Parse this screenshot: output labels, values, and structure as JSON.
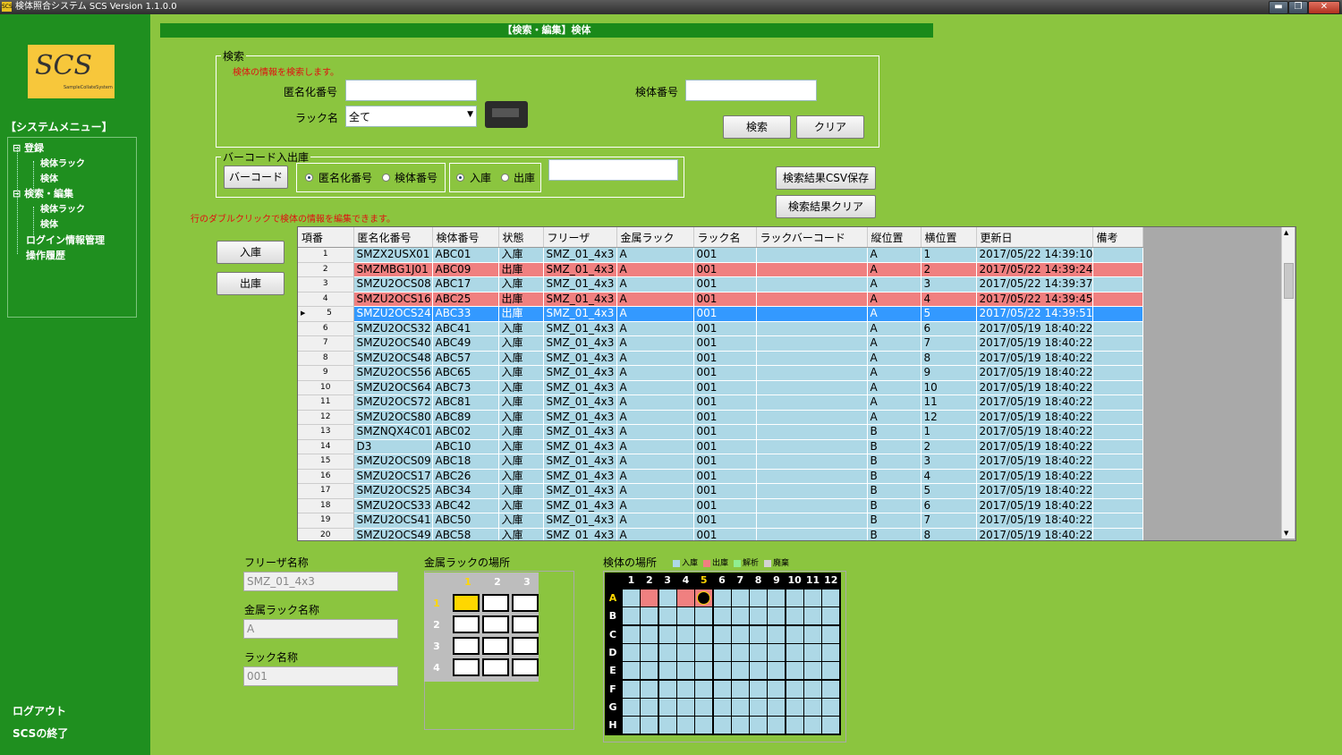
{
  "window": {
    "title": "検体照合システム  SCS Version 1.1.0.0",
    "app_icon": "SCS"
  },
  "logo": {
    "text": "SCS",
    "sub": "SampleCollateSystem"
  },
  "sidebar": {
    "menu_title": "【システムメニュー】",
    "items": [
      {
        "label": "登録",
        "level": 0
      },
      {
        "label": "検体ラック",
        "level": 1
      },
      {
        "label": "検体",
        "level": 1
      },
      {
        "label": "検索・編集",
        "level": 0
      },
      {
        "label": "検体ラック",
        "level": 1
      },
      {
        "label": "検体",
        "level": 1
      },
      {
        "label": "ログイン情報管理",
        "level": 0
      },
      {
        "label": "操作履歴",
        "level": 0
      }
    ],
    "logout": "ログアウト",
    "quit": "SCSの終了"
  },
  "header": {
    "title": "【検索・編集】検体"
  },
  "search": {
    "legend": "検索",
    "hint": "検体の情報を検索します。",
    "anon_label": "匿名化番号",
    "anon_value": "",
    "sample_label": "検体番号",
    "sample_value": "",
    "rack_label": "ラック名",
    "rack_value": "全て",
    "search_btn": "検索",
    "clear_btn": "クリア"
  },
  "barcode": {
    "legend": "バーコード入出庫",
    "barcode_btn": "バーコード",
    "opt_anon": "匿名化番号",
    "opt_sample": "検体番号",
    "opt_in": "入庫",
    "opt_out": "出庫",
    "value": ""
  },
  "actions": {
    "csv_save": "検索結果CSV保存",
    "result_clear": "検索結果クリア",
    "in_btn": "入庫",
    "out_btn": "出庫"
  },
  "grid_hint": "行のダブルクリックで検体の情報を編集できます。",
  "table": {
    "columns": [
      "項番",
      "匿名化番号",
      "検体番号",
      "状態",
      "フリーザ",
      "金属ラック",
      "ラック名",
      "ラックバーコード",
      "縦位置",
      "横位置",
      "更新日",
      "備考"
    ],
    "rows": [
      [
        "1",
        "SMZX2USX01",
        "ABC01",
        "入庫",
        "SMZ_01_4x3",
        "A",
        "001",
        "",
        "A",
        "1",
        "2017/05/22 14:39:10",
        ""
      ],
      [
        "2",
        "SMZMBG1J01",
        "ABC09",
        "出庫",
        "SMZ_01_4x3",
        "A",
        "001",
        "",
        "A",
        "2",
        "2017/05/22 14:39:24",
        ""
      ],
      [
        "3",
        "SMZU2OCS08",
        "ABC17",
        "入庫",
        "SMZ_01_4x3",
        "A",
        "001",
        "",
        "A",
        "3",
        "2017/05/22 14:39:37",
        ""
      ],
      [
        "4",
        "SMZU2OCS16",
        "ABC25",
        "出庫",
        "SMZ_01_4x3",
        "A",
        "001",
        "",
        "A",
        "4",
        "2017/05/22 14:39:45",
        ""
      ],
      [
        "5",
        "SMZU2OCS24",
        "ABC33",
        "出庫",
        "SMZ_01_4x3",
        "A",
        "001",
        "",
        "A",
        "5",
        "2017/05/22 14:39:51",
        ""
      ],
      [
        "6",
        "SMZU2OCS32",
        "ABC41",
        "入庫",
        "SMZ_01_4x3",
        "A",
        "001",
        "",
        "A",
        "6",
        "2017/05/19 18:40:22",
        ""
      ],
      [
        "7",
        "SMZU2OCS40",
        "ABC49",
        "入庫",
        "SMZ_01_4x3",
        "A",
        "001",
        "",
        "A",
        "7",
        "2017/05/19 18:40:22",
        ""
      ],
      [
        "8",
        "SMZU2OCS48",
        "ABC57",
        "入庫",
        "SMZ_01_4x3",
        "A",
        "001",
        "",
        "A",
        "8",
        "2017/05/19 18:40:22",
        ""
      ],
      [
        "9",
        "SMZU2OCS56",
        "ABC65",
        "入庫",
        "SMZ_01_4x3",
        "A",
        "001",
        "",
        "A",
        "9",
        "2017/05/19 18:40:22",
        ""
      ],
      [
        "10",
        "SMZU2OCS64",
        "ABC73",
        "入庫",
        "SMZ_01_4x3",
        "A",
        "001",
        "",
        "A",
        "10",
        "2017/05/19 18:40:22",
        ""
      ],
      [
        "11",
        "SMZU2OCS72",
        "ABC81",
        "入庫",
        "SMZ_01_4x3",
        "A",
        "001",
        "",
        "A",
        "11",
        "2017/05/19 18:40:22",
        ""
      ],
      [
        "12",
        "SMZU2OCS80",
        "ABC89",
        "入庫",
        "SMZ_01_4x3",
        "A",
        "001",
        "",
        "A",
        "12",
        "2017/05/19 18:40:22",
        ""
      ],
      [
        "13",
        "SMZNQX4C01",
        "ABC02",
        "入庫",
        "SMZ_01_4x3",
        "A",
        "001",
        "",
        "B",
        "1",
        "2017/05/19 18:40:22",
        ""
      ],
      [
        "14",
        "D3",
        "ABC10",
        "入庫",
        "SMZ_01_4x3",
        "A",
        "001",
        "",
        "B",
        "2",
        "2017/05/19 18:40:22",
        ""
      ],
      [
        "15",
        "SMZU2OCS09",
        "ABC18",
        "入庫",
        "SMZ_01_4x3",
        "A",
        "001",
        "",
        "B",
        "3",
        "2017/05/19 18:40:22",
        ""
      ],
      [
        "16",
        "SMZU2OCS17",
        "ABC26",
        "入庫",
        "SMZ_01_4x3",
        "A",
        "001",
        "",
        "B",
        "4",
        "2017/05/19 18:40:22",
        ""
      ],
      [
        "17",
        "SMZU2OCS25",
        "ABC34",
        "入庫",
        "SMZ_01_4x3",
        "A",
        "001",
        "",
        "B",
        "5",
        "2017/05/19 18:40:22",
        ""
      ],
      [
        "18",
        "SMZU2OCS33",
        "ABC42",
        "入庫",
        "SMZ_01_4x3",
        "A",
        "001",
        "",
        "B",
        "6",
        "2017/05/19 18:40:22",
        ""
      ],
      [
        "19",
        "SMZU2OCS41",
        "ABC50",
        "入庫",
        "SMZ_01_4x3",
        "A",
        "001",
        "",
        "B",
        "7",
        "2017/05/19 18:40:22",
        ""
      ],
      [
        "20",
        "SMZU2OCS49",
        "ABC58",
        "入庫",
        "SMZ_01_4x3",
        "A",
        "001",
        "",
        "B",
        "8",
        "2017/05/19 18:40:22",
        ""
      ]
    ],
    "selected_row": 5,
    "status_colors": {
      "入庫": "#add8e6",
      "出庫": "#f08080",
      "selected": "#3399ff"
    }
  },
  "details": {
    "freezer_label": "フリーザ名称",
    "freezer_value": "SMZ_01_4x3",
    "metal_rack_label": "金属ラック名称",
    "metal_rack_value": "A",
    "rack_label": "ラック名称",
    "rack_value": "001"
  },
  "metal_rack_location": {
    "title": "金属ラックの場所",
    "columns": [
      "1",
      "2",
      "3"
    ],
    "rows": [
      "1",
      "2",
      "3",
      "4"
    ],
    "highlight": {
      "row": 1,
      "col": 1,
      "color": "#ffd700"
    }
  },
  "sample_location": {
    "title": "検体の場所",
    "legend": [
      {
        "label": "入庫",
        "color": "#add8e6"
      },
      {
        "label": "出庫",
        "color": "#f08080"
      },
      {
        "label": "解析",
        "color": "#90ee90"
      },
      {
        "label": "廃棄",
        "color": "#d3d3d3"
      }
    ],
    "columns": [
      "1",
      "2",
      "3",
      "4",
      "5",
      "6",
      "7",
      "8",
      "9",
      "10",
      "11",
      "12"
    ],
    "rows": [
      "A",
      "B",
      "C",
      "D",
      "E",
      "F",
      "G",
      "H"
    ],
    "out_cells": [
      [
        "A",
        2
      ],
      [
        "A",
        4
      ],
      [
        "A",
        5
      ]
    ],
    "selected_cell": [
      "A",
      5
    ]
  }
}
